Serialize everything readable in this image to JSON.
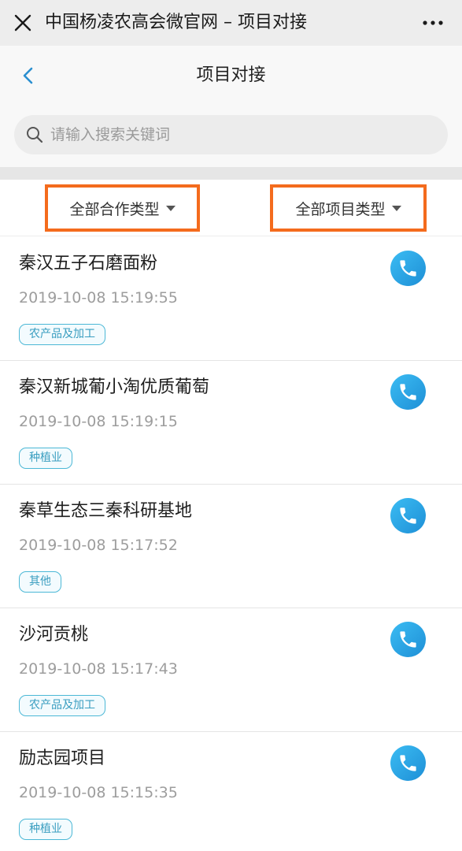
{
  "topbar": {
    "title": "中国杨凌农高会微官网 – 项目对接",
    "close_icon": "close-icon",
    "more_icon": "more-horizontal-icon"
  },
  "navbar": {
    "title": "项目对接",
    "back_icon": "chevron-left-icon"
  },
  "search": {
    "placeholder": "请输入搜索关键词",
    "icon": "search-icon"
  },
  "filters": {
    "cooperation_type": "全部合作类型",
    "project_type": "全部项目类型",
    "highlight_color": "#f46b1d"
  },
  "projects": [
    {
      "title": "秦汉五子石磨面粉",
      "time": "2019-10-08 15:19:55",
      "tag": "农产品及加工"
    },
    {
      "title": "秦汉新城葡小淘优质葡萄",
      "time": "2019-10-08 15:19:15",
      "tag": "种植业"
    },
    {
      "title": "秦草生态三秦科研基地",
      "time": "2019-10-08 15:17:52",
      "tag": "其他"
    },
    {
      "title": "沙河贡桃",
      "time": "2019-10-08 15:17:43",
      "tag": "农产品及加工"
    },
    {
      "title": "励志园项目",
      "time": "2019-10-08 15:15:35",
      "tag": "种植业"
    }
  ],
  "colors": {
    "accent": "#1e8fd6",
    "tag_border": "#4cb8d6"
  }
}
